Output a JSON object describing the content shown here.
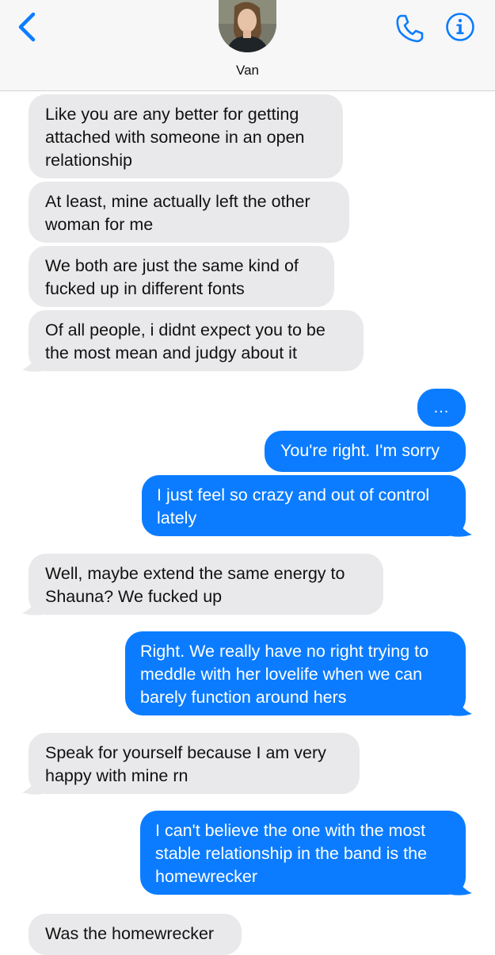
{
  "header": {
    "contact_name": "Van",
    "back_icon": "chevron-left-icon",
    "call_icon": "phone-icon",
    "details_icon": "info-icon",
    "accent": "#0b7cff"
  },
  "messages": [
    {
      "from": "them",
      "lines": [
        "Like you are any better for getting",
        "attached with someone in an open",
        "relationship"
      ]
    },
    {
      "from": "them",
      "lines": [
        "At least, mine actually left the other",
        "woman for me"
      ]
    },
    {
      "from": "them",
      "lines": [
        "We both are just the same kind of",
        "fucked up in different fonts"
      ]
    },
    {
      "from": "them",
      "lines": [
        "Of all people, i didnt expect you to be",
        "the most mean and judgy about it"
      ]
    },
    {
      "from": "me",
      "lines": [
        "..."
      ]
    },
    {
      "from": "me",
      "lines": [
        "You're right. I'm sorry"
      ]
    },
    {
      "from": "me",
      "lines": [
        "I just feel so crazy and out of control",
        "lately"
      ]
    },
    {
      "from": "them",
      "lines": [
        "Well, maybe extend the same energy to",
        "Shauna? We fucked up"
      ]
    },
    {
      "from": "me",
      "lines": [
        "Right. We really have no right trying to",
        "meddle with her lovelife when we can",
        "barely function around hers"
      ]
    },
    {
      "from": "them",
      "lines": [
        "Speak for yourself because I am very",
        "happy with mine rn"
      ]
    },
    {
      "from": "me",
      "lines": [
        "I can't believe the one with the most",
        "stable relationship in the band is the",
        "homewrecker"
      ]
    },
    {
      "from": "them",
      "lines": [
        "Was the homewrecker"
      ]
    }
  ]
}
